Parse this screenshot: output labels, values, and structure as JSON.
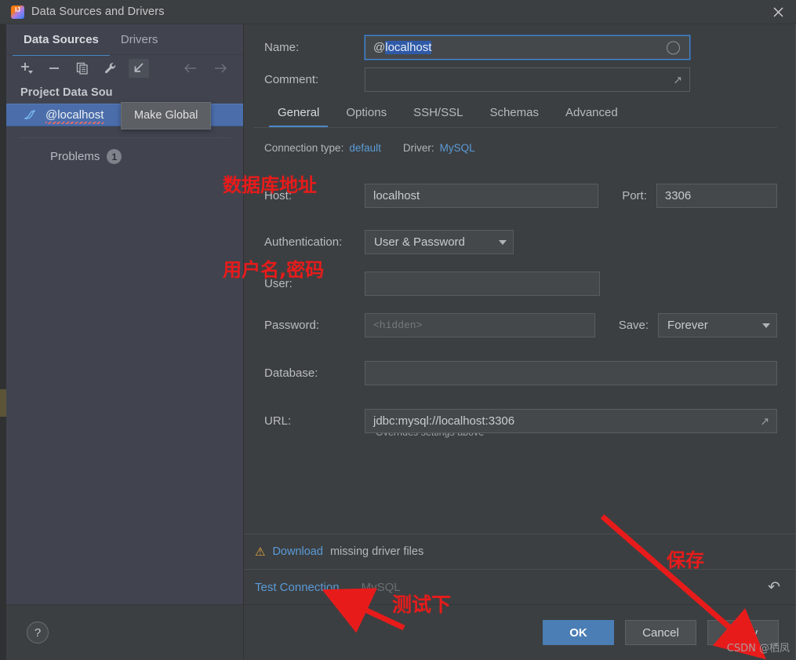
{
  "window": {
    "title": "Data Sources and Drivers",
    "app_icon": "intellij-idea-icon",
    "close_icon": "close-icon"
  },
  "sidebar": {
    "tabs": [
      {
        "label": "Data Sources",
        "active": true
      },
      {
        "label": "Drivers",
        "active": false
      }
    ],
    "toolbar": [
      {
        "name": "add-button",
        "icon": "plus-icon"
      },
      {
        "name": "remove-button",
        "icon": "minus-icon"
      },
      {
        "name": "copy-button",
        "icon": "copy-icon"
      },
      {
        "name": "properties-button",
        "icon": "wrench-icon"
      },
      {
        "name": "make-global-button",
        "icon": "arrow-down-left-icon"
      },
      {
        "name": "back-button",
        "icon": "arrow-left-icon"
      },
      {
        "name": "forward-button",
        "icon": "arrow-right-icon"
      }
    ],
    "tooltip": "Make Global",
    "group_header": "Project Data Sou",
    "data_source": {
      "label": "@localhost",
      "icon": "mysql-dolphin-icon",
      "has_error_underline": true
    },
    "problems": {
      "label": "Problems",
      "count": "1"
    },
    "help_button": "?"
  },
  "main": {
    "name": {
      "label": "Name:",
      "value": "@localhost",
      "selected_part": "localhost",
      "unselected_part": "@"
    },
    "comment": {
      "label": "Comment:",
      "value": "",
      "expand_icon": "expand-icon"
    },
    "tabs": [
      {
        "label": "General",
        "active": true
      },
      {
        "label": "Options",
        "active": false
      },
      {
        "label": "SSH/SSL",
        "active": false
      },
      {
        "label": "Schemas",
        "active": false
      },
      {
        "label": "Advanced",
        "active": false
      }
    ],
    "connection_line": {
      "connection_type_label": "Connection type:",
      "connection_type_value": "default",
      "driver_label": "Driver:",
      "driver_value": "MySQL"
    },
    "fields": {
      "host": {
        "label": "Host:",
        "value": "localhost"
      },
      "port": {
        "label": "Port:",
        "value": "3306"
      },
      "authentication": {
        "label": "Authentication:",
        "value": "User & Password"
      },
      "user": {
        "label": "User:",
        "value": ""
      },
      "password": {
        "label": "Password:",
        "value": "",
        "placeholder": "<hidden>"
      },
      "save": {
        "label": "Save:",
        "value": "Forever"
      },
      "database": {
        "label": "Database:",
        "value": ""
      },
      "url": {
        "label": "URL:",
        "value": "jdbc:mysql://localhost:3306",
        "expand_icon": "expand-icon"
      },
      "url_note": "Overrides settings above"
    },
    "driver_bar": {
      "warn_icon": "warning-triangle-icon",
      "link": "Download",
      "rest": "missing driver files"
    },
    "test_bar": {
      "test_connection": "Test Connection",
      "ghost_text": "MySQL",
      "revert_icon": "revert-undo-icon"
    },
    "buttons": {
      "ok": "OK",
      "cancel": "Cancel",
      "apply": "Apply"
    }
  },
  "annotations": [
    {
      "name": "annotation-database-address",
      "text": "数据库地址"
    },
    {
      "name": "annotation-username-password",
      "text": "用户名,密码"
    },
    {
      "name": "annotation-save",
      "text": "保存"
    },
    {
      "name": "annotation-test",
      "text": "测试下"
    }
  ],
  "watermark": "CSDN @栖凤",
  "colors": {
    "window_bg": "#3c3f41",
    "sidebar_bg": "#41444f",
    "accent_blue": "#4a88c7",
    "selection_blue": "#4b6eab",
    "primary_button": "#4a7eb5",
    "link": "#5a9bd8",
    "annotation_red": "#e81b1b",
    "warning": "#e8a33d"
  }
}
